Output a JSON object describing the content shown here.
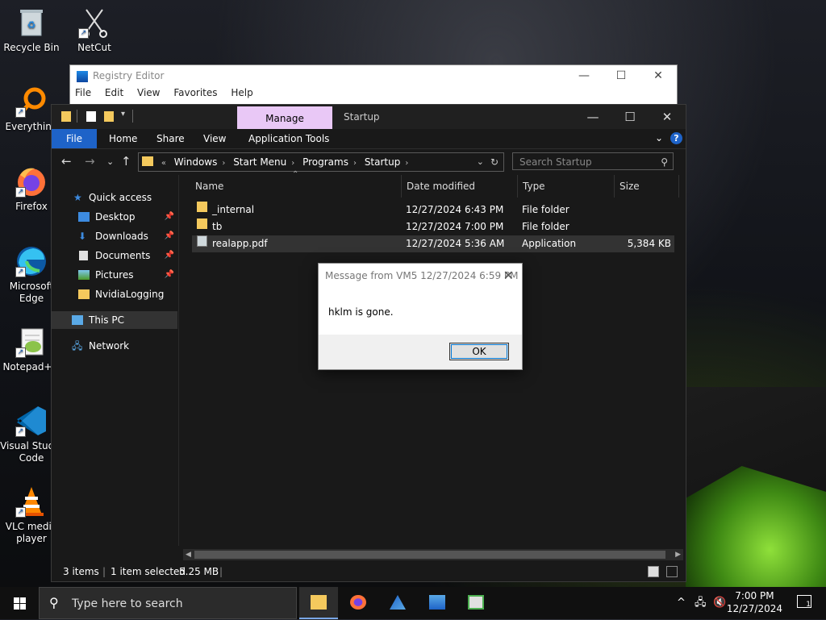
{
  "desktop": {
    "icons": [
      {
        "label": "Recycle Bin"
      },
      {
        "label": "NetCut"
      },
      {
        "label": "Everything"
      },
      {
        "label": "Firefox"
      },
      {
        "label": "Microsoft Edge"
      },
      {
        "label": "Notepad++"
      },
      {
        "label": "Visual Studio Code"
      },
      {
        "label": "VLC media player"
      }
    ]
  },
  "regedit": {
    "title": "Registry Editor",
    "menu": [
      "File",
      "Edit",
      "View",
      "Favorites",
      "Help"
    ]
  },
  "explorer": {
    "contextual_tab": "Manage",
    "title": "Startup",
    "ribbon_tabs": [
      "File",
      "Home",
      "Share",
      "View",
      "Application Tools"
    ],
    "breadcrumb": [
      "Windows",
      "Start Menu",
      "Programs",
      "Startup"
    ],
    "breadcrumb_prefix": "«",
    "search_placeholder": "Search Startup",
    "nav": {
      "quick_access": "Quick access",
      "items": [
        "Desktop",
        "Downloads",
        "Documents",
        "Pictures",
        "NvidiaLogging"
      ],
      "this_pc": "This PC",
      "network": "Network"
    },
    "columns": [
      "Name",
      "Date modified",
      "Type",
      "Size"
    ],
    "files": [
      {
        "name": "_internal",
        "date": "12/27/2024 6:43 PM",
        "type": "File folder",
        "size": "",
        "kind": "folder"
      },
      {
        "name": "tb",
        "date": "12/27/2024 7:00 PM",
        "type": "File folder",
        "size": "",
        "kind": "folder"
      },
      {
        "name": "realapp.pdf",
        "date": "12/27/2024 5:36 AM",
        "type": "Application",
        "size": "5,384 KB",
        "kind": "app"
      }
    ],
    "status": {
      "items": "3 items",
      "selected": "1 item selected",
      "selected_size": "5.25 MB"
    }
  },
  "dialog": {
    "title": "Message from VM5 12/27/2024 6:59 PM",
    "message": "hklm is gone.",
    "ok": "OK"
  },
  "taskbar": {
    "search_placeholder": "Type here to search",
    "time": "7:00 PM",
    "date": "12/27/2024",
    "notification_count": "1"
  },
  "colors": {
    "accent": "#1e63c8",
    "manage_tab": "#e9c8f6",
    "folder": "#f4c95d"
  }
}
